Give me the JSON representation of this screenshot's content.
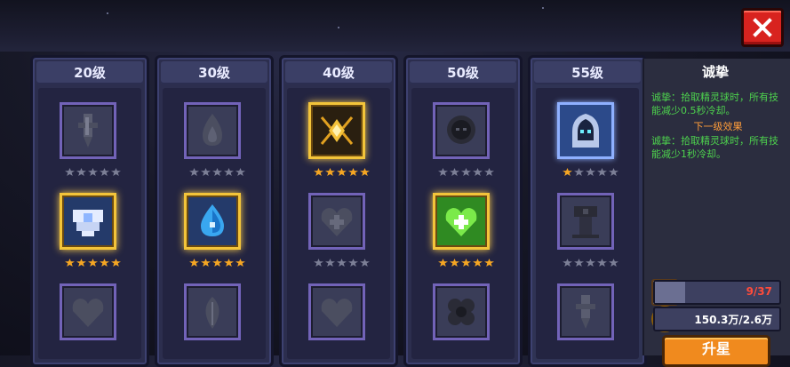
{
  "columns": [
    {
      "label": "20级",
      "slots": [
        {
          "icon": "sword-icon",
          "state": "locked",
          "stars": 0
        },
        {
          "icon": "shirt-icon",
          "state": "maxed",
          "stars": 5
        },
        {
          "icon": "heart-icon",
          "state": "locked",
          "stars": 0
        }
      ]
    },
    {
      "label": "30级",
      "slots": [
        {
          "icon": "flame-icon",
          "state": "locked",
          "stars": 0
        },
        {
          "icon": "water-drop-icon",
          "state": "maxed",
          "stars": 5
        },
        {
          "icon": "leaf-icon",
          "state": "locked",
          "stars": 0
        }
      ]
    },
    {
      "label": "40级",
      "slots": [
        {
          "icon": "crystal-icon",
          "state": "maxed",
          "stars": 5
        },
        {
          "icon": "heart-plus-icon",
          "state": "locked",
          "stars": 0
        },
        {
          "icon": "heart-icon",
          "state": "locked",
          "stars": 0
        }
      ]
    },
    {
      "label": "50级",
      "slots": [
        {
          "icon": "ghost-icon",
          "state": "locked",
          "stars": 0
        },
        {
          "icon": "heart-plus-icon",
          "state": "maxed",
          "stars": 5
        },
        {
          "icon": "cluster-icon",
          "state": "locked",
          "stars": 0
        }
      ]
    },
    {
      "label": "55级",
      "slots": [
        {
          "icon": "hooded-spirit-icon",
          "state": "selected",
          "stars": 1
        },
        {
          "icon": "turret-icon",
          "state": "locked",
          "stars": 0
        },
        {
          "icon": "sword-icon",
          "state": "locked",
          "stars": 0
        }
      ]
    }
  ],
  "detail": {
    "title": "诚挚",
    "current_effect": "诚挚：拾取精灵球时，所有技能减少0.5秒冷却。",
    "next_label": "下一级效果",
    "next_effect": "诚挚：拾取精灵球时，所有技能减少1秒冷却。"
  },
  "fragments": {
    "current": 9,
    "required": 37,
    "text": "9/37",
    "color": "#ff4b3a"
  },
  "gold": {
    "text": "150.3万/2.6万",
    "color": "#ffffff"
  },
  "upgrade_label": "升星",
  "colors": {
    "frame": "#7263b8",
    "gold_frame": "#f3c43a",
    "star_on": "#f5a623",
    "star_off": "#7c7f96",
    "effect_text": "#4dd24d",
    "next_label": "#ff9d3a",
    "close": "#d8231f"
  }
}
